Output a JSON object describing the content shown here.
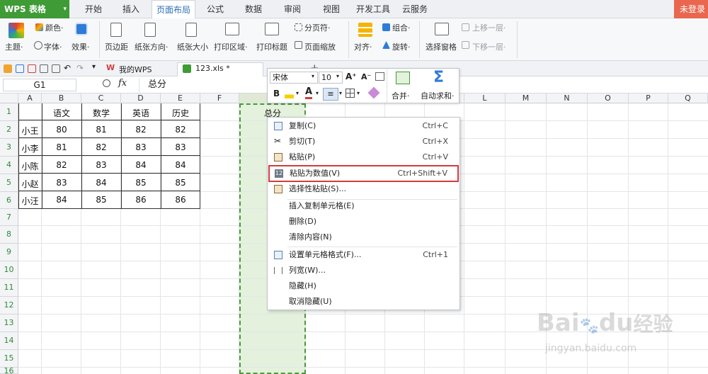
{
  "app": {
    "name": "WPS 表格",
    "login": "未登录"
  },
  "menu_tabs": [
    "开始",
    "插入",
    "页面布局",
    "公式",
    "数据",
    "审阅",
    "视图",
    "开发工具",
    "云服务"
  ],
  "active_tab": "页面布局",
  "ribbon": {
    "theme": "主题·",
    "color": "颜色·",
    "font": "字体·",
    "effect": "效果·",
    "margin": "页边距",
    "orientation": "纸张方向·",
    "size": "纸张大小",
    "print_area": "打印区域·",
    "print_title": "打印标题",
    "page_break": "分页符·",
    "page_zoom": "页面缩放",
    "align": "对齐·",
    "group": "组合·",
    "rotate": "旋转·",
    "selection_pane": "选择窗格",
    "bring_forward": "上移一层·",
    "send_backward": "下移一层·"
  },
  "qbar": {
    "tab1": "我的WPS",
    "tab2": "123.xls *",
    "add": "+"
  },
  "formula_bar": {
    "cell_ref": "G1",
    "fx": "fx",
    "value": "总分"
  },
  "mini_toolbar": {
    "font": "宋体",
    "size": "10",
    "bold": "B",
    "font_color": "A",
    "merge": "合并·",
    "autosum": "自动求和·"
  },
  "columns": [
    "A",
    "B",
    "C",
    "D",
    "E",
    "F",
    "G",
    "H",
    "I",
    "J",
    "K",
    "L",
    "M",
    "N",
    "O",
    "P",
    "Q"
  ],
  "rows": [
    "1",
    "2",
    "3",
    "4",
    "5",
    "6",
    "7",
    "8",
    "9",
    "10",
    "11",
    "12",
    "13",
    "14",
    "15",
    "16"
  ],
  "table": {
    "headers": [
      "语文",
      "数学",
      "英语",
      "历史"
    ],
    "names": [
      "小王",
      "小李",
      "小陈",
      "小赵",
      "小汪"
    ],
    "values": [
      [
        "80",
        "81",
        "82",
        "82"
      ],
      [
        "81",
        "82",
        "83",
        "83"
      ],
      [
        "82",
        "83",
        "84",
        "84"
      ],
      [
        "83",
        "84",
        "85",
        "85"
      ],
      [
        "84",
        "85",
        "86",
        "86"
      ]
    ],
    "g1": "总分"
  },
  "context_menu": [
    {
      "label": "复制(C)",
      "shortcut": "Ctrl+C"
    },
    {
      "label": "剪切(T)",
      "shortcut": "Ctrl+X"
    },
    {
      "label": "粘贴(P)",
      "shortcut": "Ctrl+V"
    },
    {
      "label": "粘贴为数值(V)",
      "shortcut": "Ctrl+Shift+V"
    },
    {
      "label": "选择性粘贴(S)...",
      "shortcut": ""
    },
    {
      "label": "插入复制单元格(E)",
      "shortcut": ""
    },
    {
      "label": "删除(D)",
      "shortcut": ""
    },
    {
      "label": "清除内容(N)",
      "shortcut": ""
    },
    {
      "label": "设置单元格格式(F)...",
      "shortcut": "Ctrl+1"
    },
    {
      "label": "列宽(W)...",
      "shortcut": ""
    },
    {
      "label": "隐藏(H)",
      "shortcut": ""
    },
    {
      "label": "取消隐藏(U)",
      "shortcut": ""
    }
  ],
  "watermark": {
    "brand": "Bai",
    "du": "du",
    "jingyan": "经验",
    "url": "jingyan.baidu.com"
  },
  "colors": {
    "accent_green": "#3e9b35",
    "selection_fill": "#e4f1dc",
    "highlight_border": "#d23c3c",
    "active_tab_text": "#2c6fb8"
  }
}
